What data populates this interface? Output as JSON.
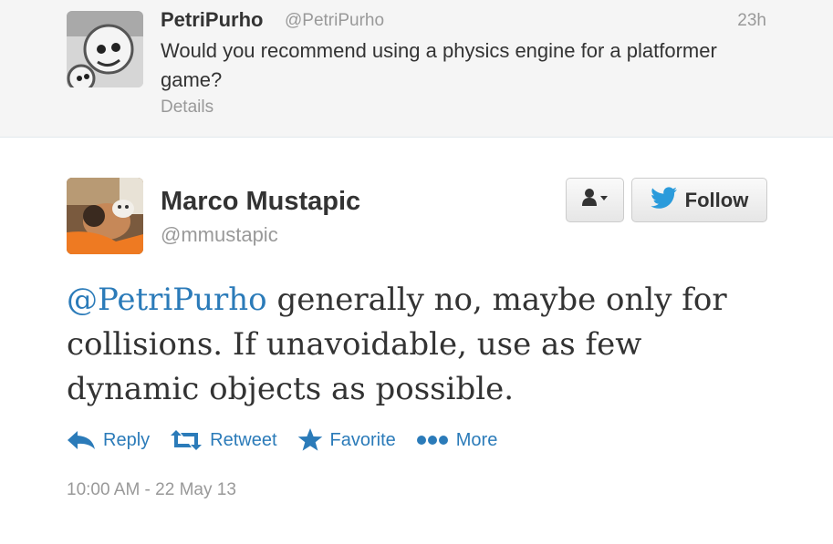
{
  "parent_tweet": {
    "author_name": "PetriPurho",
    "author_handle": "@PetriPurho",
    "time": "23h",
    "text": "Would you recommend using a physics engine for a platformer game?",
    "details_link": "Details"
  },
  "tweet": {
    "author_name": "Marco Mustapic",
    "author_handle": "@mmustapic",
    "mention": "@PetriPurho",
    "text": " generally no, maybe only for collisions. If unavoidable, use as few dynamic objects as possible.",
    "timestamp": "10:00 AM - 22 May 13"
  },
  "buttons": {
    "user_dropdown_icon": "user-caret-icon",
    "follow_icon": "twitter-bird-icon",
    "follow_label": "Follow"
  },
  "actions": [
    {
      "label": "Reply",
      "icon": "reply-arrow-icon"
    },
    {
      "label": "Retweet",
      "icon": "retweet-icon"
    },
    {
      "label": "Favorite",
      "icon": "star-icon"
    },
    {
      "label": "More",
      "icon": "more-dots-icon"
    }
  ],
  "colors": {
    "link": "#2b7bb9",
    "muted": "#999999",
    "text": "#333333",
    "parent_background": "#f5f5f5"
  }
}
